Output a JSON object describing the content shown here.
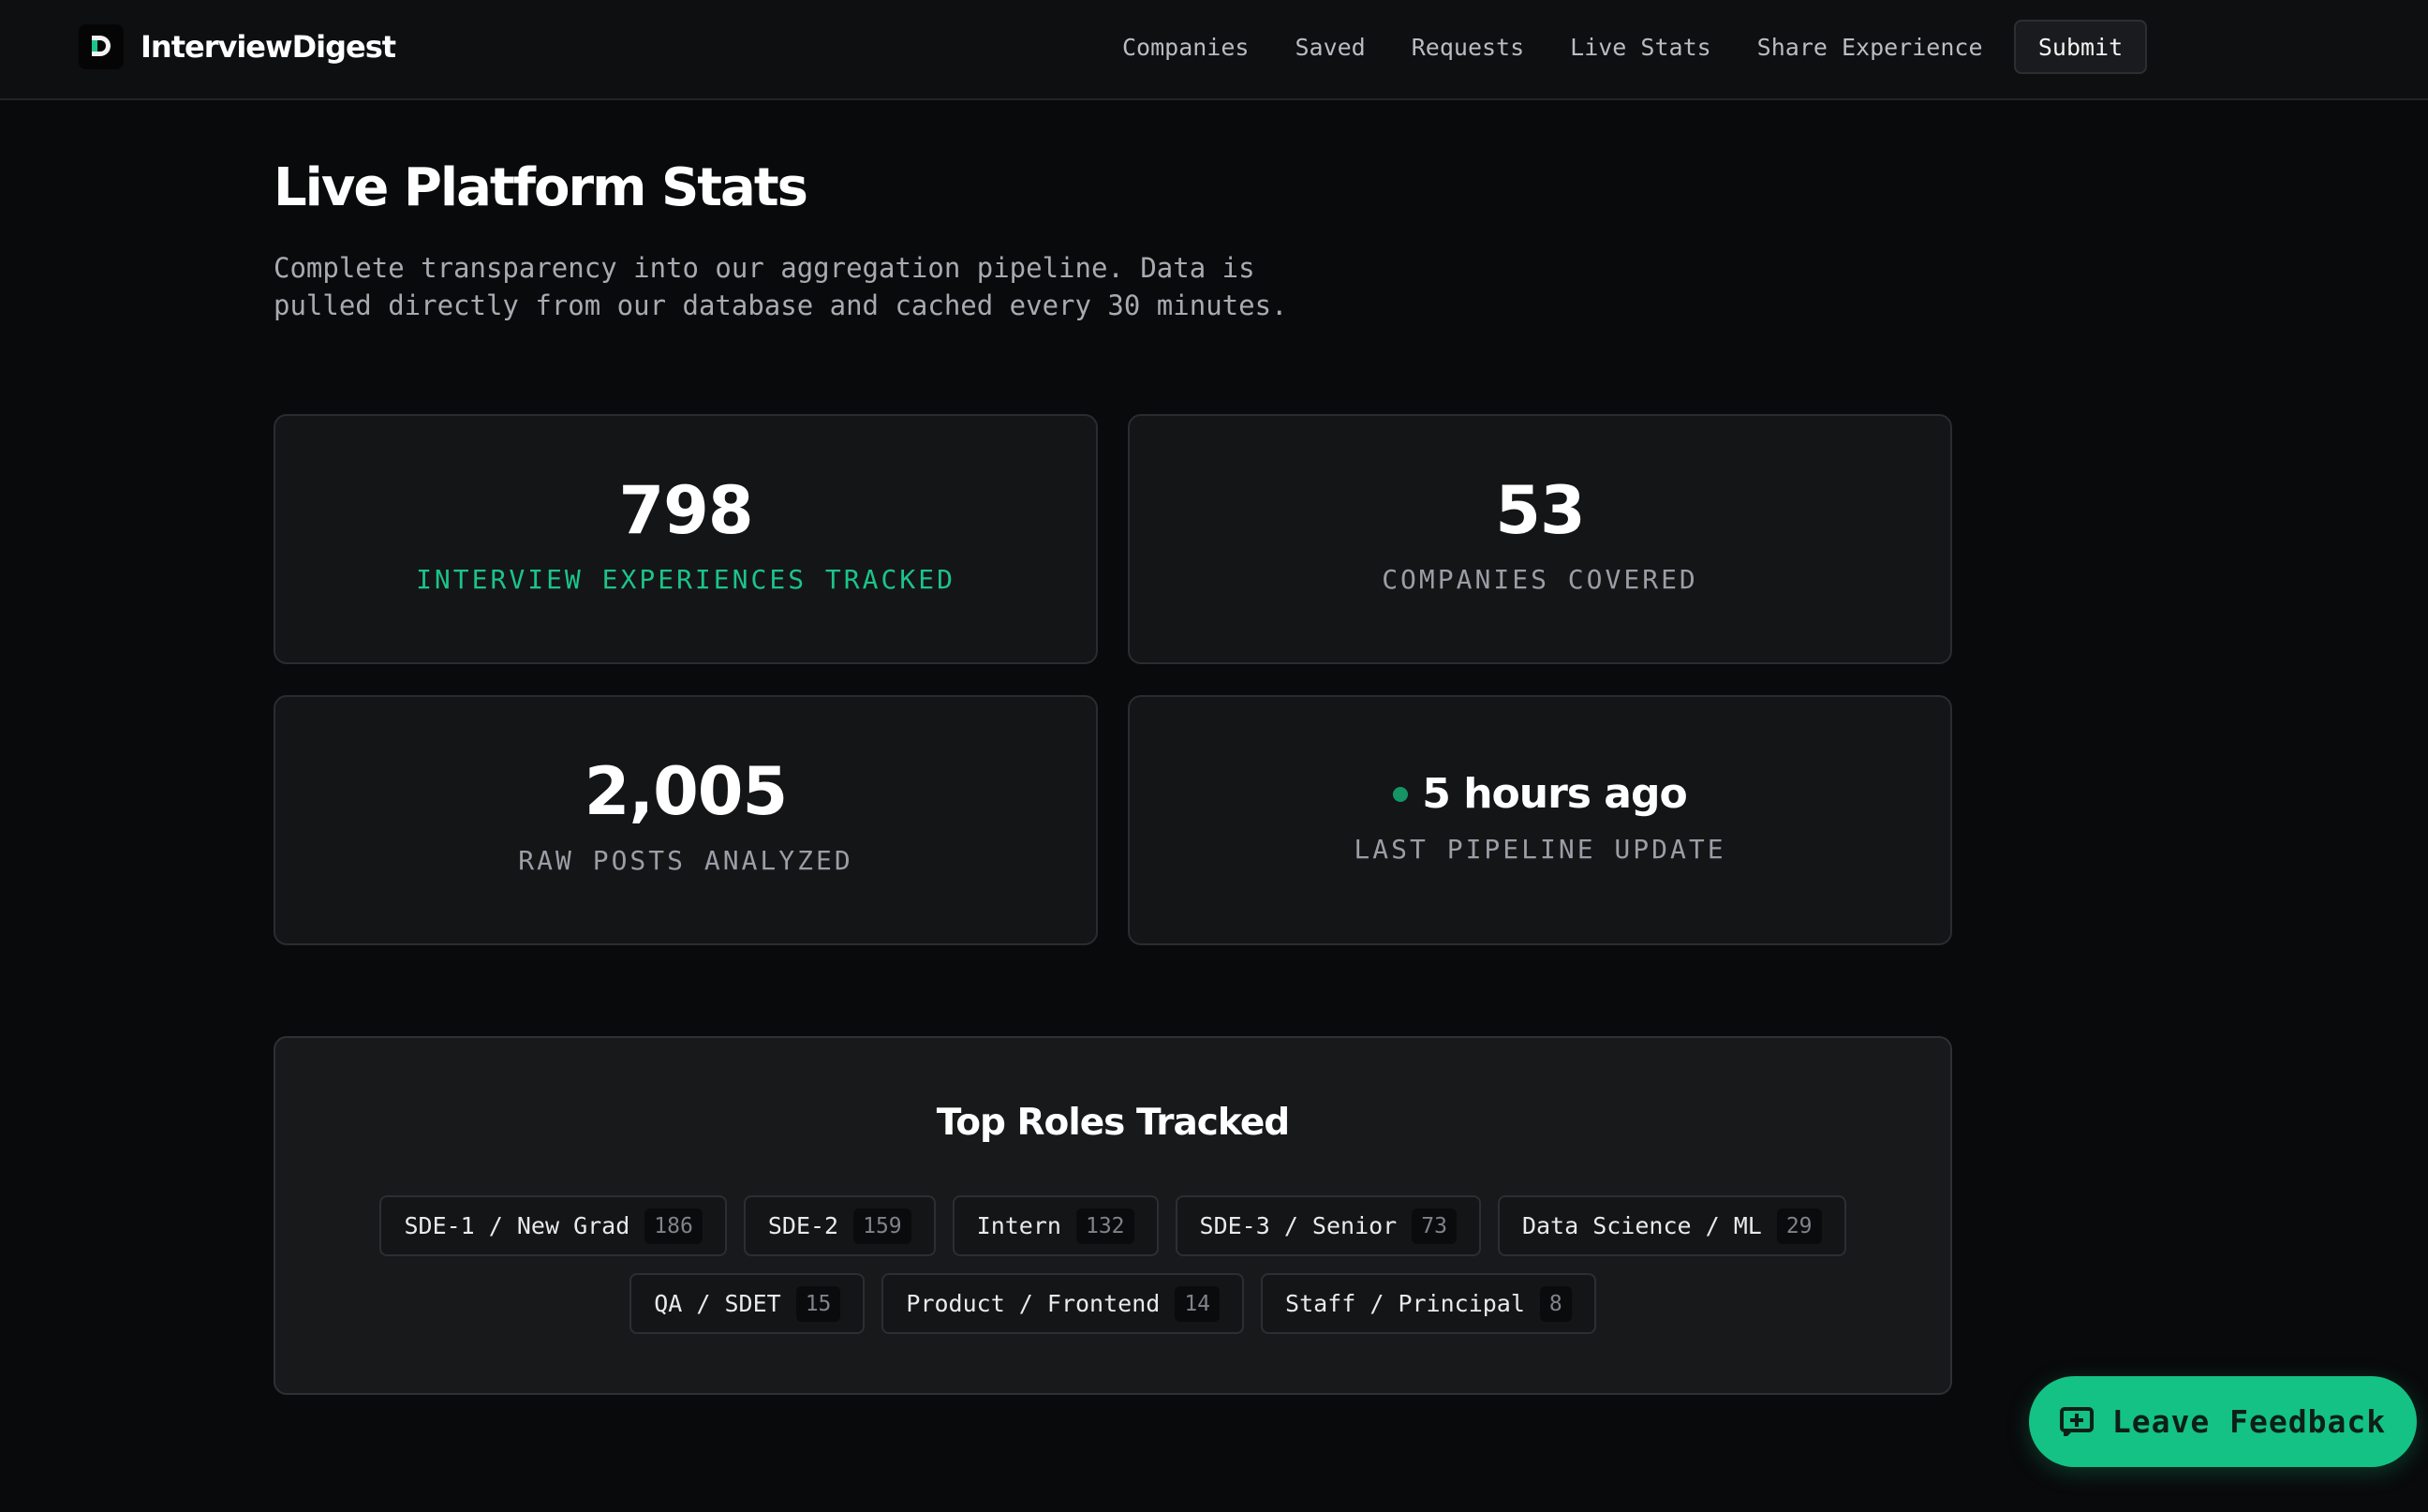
{
  "brand": {
    "name": "InterviewDigest",
    "logo_icon": "logo-d-icon"
  },
  "nav": {
    "links": [
      "Companies",
      "Saved",
      "Requests",
      "Live Stats",
      "Share Experience"
    ],
    "submit_label": "Submit"
  },
  "header": {
    "title": "Live Platform Stats",
    "description": "Complete transparency into our aggregation pipeline. Data is pulled directly from our database and cached every 30 minutes."
  },
  "stats": [
    {
      "value": "798",
      "label": "INTERVIEW EXPERIENCES TRACKED"
    },
    {
      "value": "53",
      "label": "COMPANIES COVERED"
    },
    {
      "value": "2,005",
      "label": "RAW POSTS ANALYZED"
    },
    {
      "value": "5 hours ago",
      "label": "LAST PIPELINE UPDATE"
    }
  ],
  "roles": {
    "title": "Top Roles Tracked",
    "items": [
      {
        "label": "SDE-1 / New Grad",
        "count": "186"
      },
      {
        "label": "SDE-2",
        "count": "159"
      },
      {
        "label": "Intern",
        "count": "132"
      },
      {
        "label": "SDE-3 / Senior",
        "count": "73"
      },
      {
        "label": "Data Science / ML",
        "count": "29"
      },
      {
        "label": "QA / SDET",
        "count": "15"
      },
      {
        "label": "Product / Frontend",
        "count": "14"
      },
      {
        "label": "Staff / Principal",
        "count": "8"
      }
    ]
  },
  "feedback": {
    "label": "Leave Feedback",
    "icon": "message-plus-icon"
  },
  "colors": {
    "accent": "#1bc488",
    "status_dot": "#159566",
    "background": "#090a0b",
    "card": "#141517"
  }
}
